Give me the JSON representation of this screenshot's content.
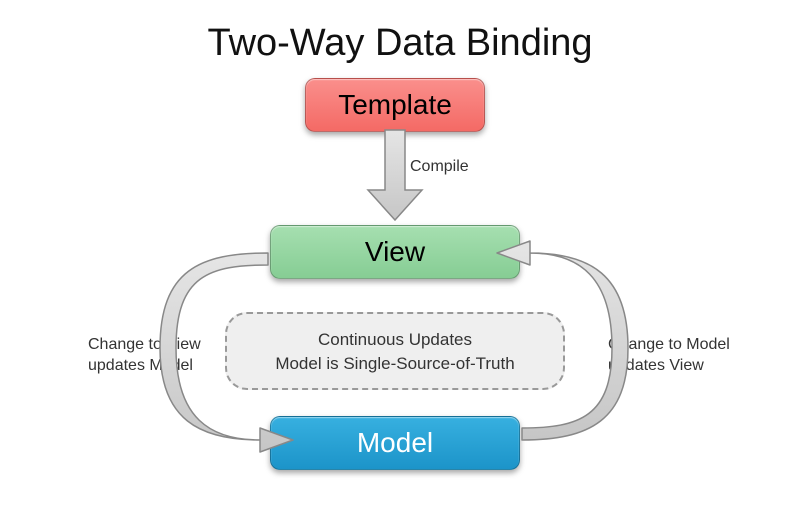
{
  "title": "Two-Way Data Binding",
  "nodes": {
    "template": "Template",
    "view": "View",
    "model": "Model"
  },
  "arrow_labels": {
    "compile": "Compile",
    "left_line1": "Change to View",
    "left_line2": "updates Model",
    "right_line1": "Change to Model",
    "right_line2": "updates View"
  },
  "center_box": {
    "line1": "Continuous Updates",
    "line2": "Model is Single-Source-of-Truth"
  }
}
